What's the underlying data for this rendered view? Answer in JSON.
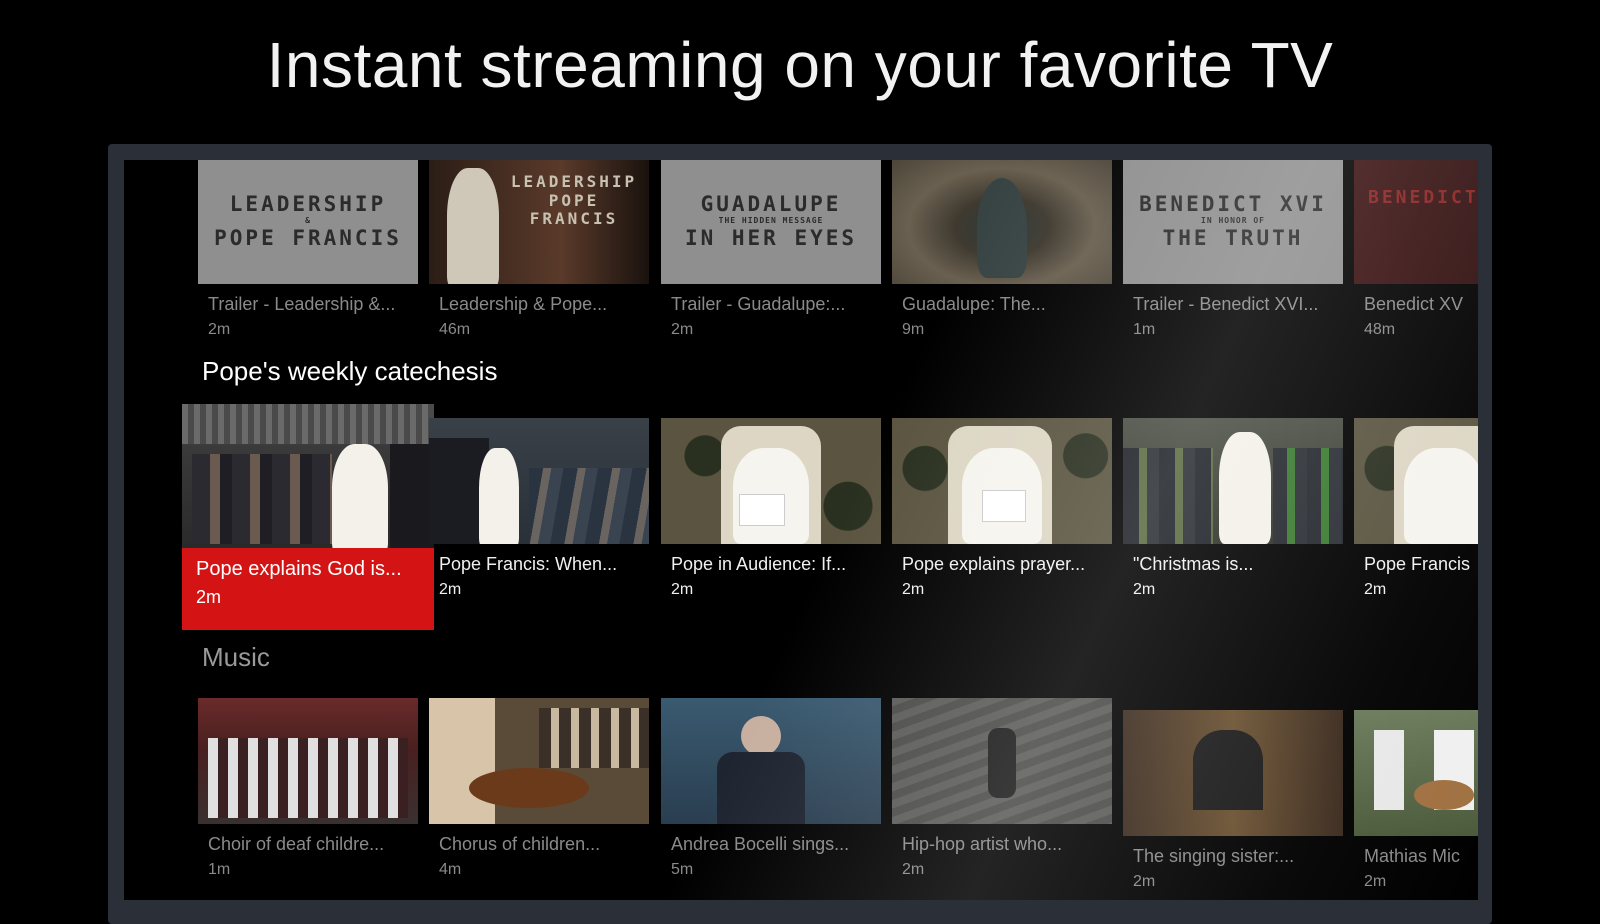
{
  "headline": "Instant streaming on your favorite TV",
  "rows": [
    {
      "title": "",
      "cards": [
        {
          "title": "Trailer - Leadership &...",
          "duration": "2m",
          "art": "LEADERSHIP|POPE FRANCIS",
          "art_small": "&",
          "bg": "#8f8f8f"
        },
        {
          "title": "Leadership & Pope...",
          "duration": "46m",
          "art": "LEADERSHIP|POPE FRANCIS",
          "art_small": "&",
          "bg": "#3a2a22"
        },
        {
          "title": "Trailer - Guadalupe:...",
          "duration": "2m",
          "art": "GUADALUPE|IN HER EYES",
          "art_small": "THE HIDDEN MESSAGE",
          "bg": "#8f8f8f"
        },
        {
          "title": "Guadalupe: The...",
          "duration": "9m",
          "art": "",
          "art_small": "",
          "bg": "#5c5648"
        },
        {
          "title": "Trailer - Benedict XVI...",
          "duration": "1m",
          "art": "BENEDICT XVI|THE TRUTH",
          "art_small": "IN HONOR OF",
          "bg": "#8f8f8f"
        },
        {
          "title": "Benedict XV",
          "duration": "48m",
          "art": "BENEDICT",
          "art_small": "",
          "bg": "#3a1414"
        }
      ]
    },
    {
      "title": "Pope's weekly catechesis",
      "cards": [
        {
          "title": "Pope explains God is...",
          "duration": "2m",
          "bg": "#4a4a4a"
        },
        {
          "title": "Pope Francis: When...",
          "duration": "2m",
          "bg": "#3e4650"
        },
        {
          "title": "Pope in Audience: If...",
          "duration": "2m",
          "bg": "#4d4a38"
        },
        {
          "title": "Pope explains prayer...",
          "duration": "2m",
          "bg": "#4d4a38"
        },
        {
          "title": "\"Christmas is...",
          "duration": "2m",
          "bg": "#3f4a38"
        },
        {
          "title": "Pope Francis",
          "duration": "2m",
          "bg": "#4d4a38"
        }
      ]
    },
    {
      "title": "Music",
      "cards": [
        {
          "title": "Choir of deaf childre...",
          "duration": "1m",
          "bg": "#5a2626"
        },
        {
          "title": "Chorus of children...",
          "duration": "4m",
          "bg": "#4a3a2a"
        },
        {
          "title": "Andrea Bocelli sings...",
          "duration": "5m",
          "bg": "#2e4458"
        },
        {
          "title": "Hip-hop artist who...",
          "duration": "2m",
          "bg": "#4a4a48"
        },
        {
          "title": "The singing sister:...",
          "duration": "2m",
          "bg": "#4a3828"
        },
        {
          "title": "Mathias Mic",
          "duration": "2m",
          "bg": "#3f4f38"
        }
      ]
    }
  ]
}
